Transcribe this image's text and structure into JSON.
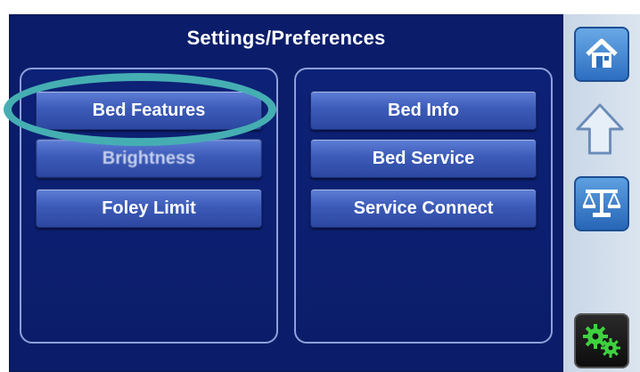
{
  "header": {
    "title": "Settings/Preferences"
  },
  "left_panel": {
    "buttons": [
      {
        "label": "Bed Features"
      },
      {
        "label": "Brightness"
      },
      {
        "label": "Foley Limit"
      }
    ]
  },
  "right_panel": {
    "buttons": [
      {
        "label": "Bed Info"
      },
      {
        "label": "Bed Service"
      },
      {
        "label": "Service Connect"
      }
    ]
  },
  "sidebar": {
    "icons": [
      "home-icon",
      "up-arrow-icon",
      "scale-icon",
      "gears-icon"
    ]
  },
  "colors": {
    "screen_bg": "#0b1d6a",
    "button": "#3c5bb8",
    "highlight_ring": "#45aeb2",
    "gear_green": "#3fd13f"
  }
}
